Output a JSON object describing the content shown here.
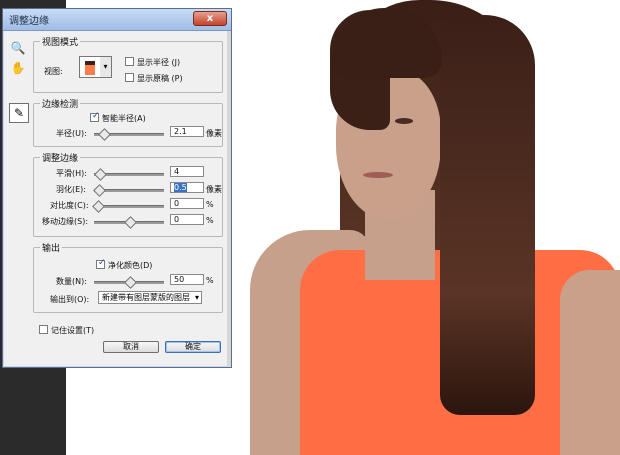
{
  "dialog": {
    "title": "调整边缘",
    "close_label": "x"
  },
  "view_mode": {
    "section": "视图模式",
    "view_label": "视图:",
    "show_radius_label": "显示半径 (J)",
    "show_original_label": "显示原稿 (P)"
  },
  "edge_detect": {
    "section": "边缘检测",
    "smart_radius_label": "智能半径(A)",
    "radius_label": "半径(U):",
    "radius_value": "2.1",
    "radius_unit": "像素"
  },
  "adjust_edge": {
    "section": "调整边缘",
    "smooth_label": "平滑(H):",
    "smooth_value": "4",
    "feather_label": "羽化(E):",
    "feather_value": "0.5",
    "feather_unit": "像素",
    "contrast_label": "对比度(C):",
    "contrast_value": "0",
    "contrast_unit": "%",
    "shift_label": "移动边缘(S):",
    "shift_value": "0",
    "shift_unit": "%"
  },
  "output": {
    "section": "输出",
    "decontaminate_label": "净化颜色(D)",
    "amount_label": "数量(N):",
    "amount_value": "50",
    "amount_unit": "%",
    "output_to_label": "输出到(O):",
    "output_to_value": "新建带有图层蒙版的图层"
  },
  "footer": {
    "remember_label": "记住设置(T)",
    "cancel_label": "取消",
    "ok_label": "确定"
  },
  "icons": {
    "zoom": "zoom-icon",
    "hand": "hand-icon",
    "brush": "refine-brush-icon"
  }
}
